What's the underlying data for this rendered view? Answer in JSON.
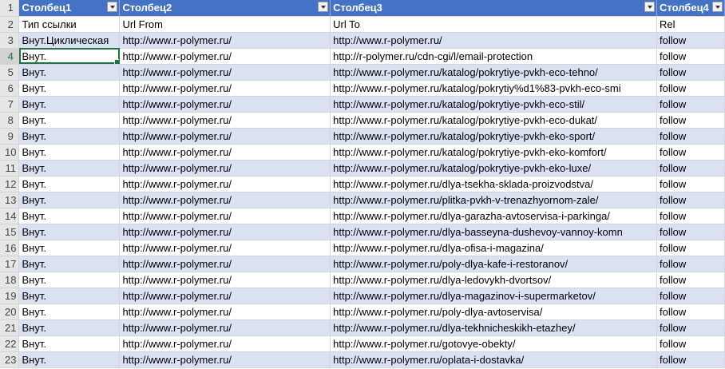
{
  "header": {
    "row": "1",
    "col1": "Столбец1",
    "col2": "Столбец2",
    "col3": "Столбец3",
    "col4": "Столбец4"
  },
  "rows": [
    {
      "n": "2",
      "c1": "Тип ссылки",
      "c2": "Url From",
      "c3": "Url To",
      "c4": "Rel"
    },
    {
      "n": "3",
      "c1": "Внут.Циклическая",
      "c2": "http://www.r-polymer.ru/",
      "c3": "http://www.r-polymer.ru/",
      "c4": "follow"
    },
    {
      "n": "4",
      "c1": "Внут.",
      "c2": "http://www.r-polymer.ru/",
      "c3": "http://r-polymer.ru/cdn-cgi/l/email-protection",
      "c4": "follow"
    },
    {
      "n": "5",
      "c1": "Внут.",
      "c2": "http://www.r-polymer.ru/",
      "c3": "http://www.r-polymer.ru/katalog/pokrytiye-pvkh-eco-tehno/",
      "c4": "follow"
    },
    {
      "n": "6",
      "c1": "Внут.",
      "c2": "http://www.r-polymer.ru/",
      "c3": "http://www.r-polymer.ru/katalog/pokrytiy%d1%83-pvkh-eco-smi",
      "c4": "follow"
    },
    {
      "n": "7",
      "c1": "Внут.",
      "c2": "http://www.r-polymer.ru/",
      "c3": "http://www.r-polymer.ru/katalog/pokrytiye-pvkh-eco-stil/",
      "c4": "follow"
    },
    {
      "n": "8",
      "c1": "Внут.",
      "c2": "http://www.r-polymer.ru/",
      "c3": "http://www.r-polymer.ru/katalog/pokrytiye-pvkh-eco-dukat/",
      "c4": "follow"
    },
    {
      "n": "9",
      "c1": "Внут.",
      "c2": "http://www.r-polymer.ru/",
      "c3": "http://www.r-polymer.ru/katalog/pokrytiye-pvkh-eko-sport/",
      "c4": "follow"
    },
    {
      "n": "10",
      "c1": "Внут.",
      "c2": "http://www.r-polymer.ru/",
      "c3": "http://www.r-polymer.ru/katalog/pokrytiye-pvkh-eko-komfort/",
      "c4": "follow"
    },
    {
      "n": "11",
      "c1": "Внут.",
      "c2": "http://www.r-polymer.ru/",
      "c3": "http://www.r-polymer.ru/katalog/pokrytiye-pvkh-eko-luxe/",
      "c4": "follow"
    },
    {
      "n": "12",
      "c1": "Внут.",
      "c2": "http://www.r-polymer.ru/",
      "c3": "http://www.r-polymer.ru/dlya-tsekha-sklada-proizvodstva/",
      "c4": "follow"
    },
    {
      "n": "13",
      "c1": "Внут.",
      "c2": "http://www.r-polymer.ru/",
      "c3": "http://www.r-polymer.ru/plitka-pvkh-v-trenazhyornom-zale/",
      "c4": "follow"
    },
    {
      "n": "14",
      "c1": "Внут.",
      "c2": "http://www.r-polymer.ru/",
      "c3": "http://www.r-polymer.ru/dlya-garazha-avtoservisa-i-parkinga/",
      "c4": "follow"
    },
    {
      "n": "15",
      "c1": "Внут.",
      "c2": "http://www.r-polymer.ru/",
      "c3": "http://www.r-polymer.ru/dlya-basseyna-dushevoy-vannoy-komn",
      "c4": "follow"
    },
    {
      "n": "16",
      "c1": "Внут.",
      "c2": "http://www.r-polymer.ru/",
      "c3": "http://www.r-polymer.ru/dlya-ofisa-i-magazina/",
      "c4": "follow"
    },
    {
      "n": "17",
      "c1": "Внут.",
      "c2": "http://www.r-polymer.ru/",
      "c3": "http://www.r-polymer.ru/poly-dlya-kafe-i-restoranov/",
      "c4": "follow"
    },
    {
      "n": "18",
      "c1": "Внут.",
      "c2": "http://www.r-polymer.ru/",
      "c3": "http://www.r-polymer.ru/dlya-ledovykh-dvortsov/",
      "c4": "follow"
    },
    {
      "n": "19",
      "c1": "Внут.",
      "c2": "http://www.r-polymer.ru/",
      "c3": "http://www.r-polymer.ru/dlya-magazinov-i-supermarketov/",
      "c4": "follow"
    },
    {
      "n": "20",
      "c1": "Внут.",
      "c2": "http://www.r-polymer.ru/",
      "c3": "http://www.r-polymer.ru/poly-dlya-avtoservisa/",
      "c4": "follow"
    },
    {
      "n": "21",
      "c1": "Внут.",
      "c2": "http://www.r-polymer.ru/",
      "c3": "http://www.r-polymer.ru/dlya-tekhnicheskikh-etazhey/",
      "c4": "follow"
    },
    {
      "n": "22",
      "c1": "Внут.",
      "c2": "http://www.r-polymer.ru/",
      "c3": "http://www.r-polymer.ru/gotovye-obekty/",
      "c4": "follow"
    },
    {
      "n": "23",
      "c1": "Внут.",
      "c2": "http://www.r-polymer.ru/",
      "c3": "http://www.r-polymer.ru/oplata-i-dostavka/",
      "c4": "follow"
    }
  ],
  "selection": {
    "row": "4",
    "column": "A"
  },
  "colors": {
    "header_bg": "#4472c4",
    "band_bg": "#d9e1f2",
    "selection": "#217346"
  }
}
